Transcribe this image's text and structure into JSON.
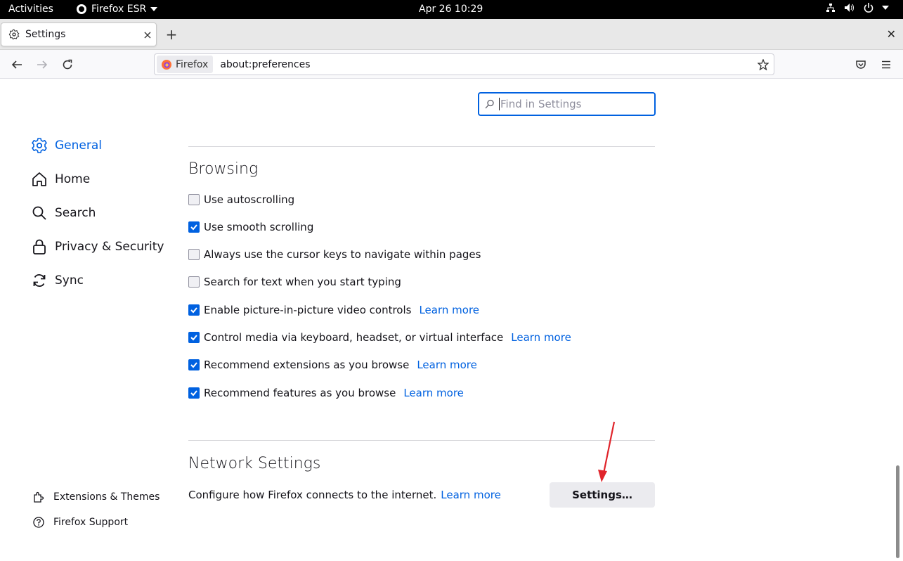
{
  "topbar": {
    "activities": "Activities",
    "app_name": "Firefox ESR",
    "clock": "Apr 26  10:29"
  },
  "tab": {
    "title": "Settings",
    "close": "×",
    "new_tab": "+"
  },
  "urlbar": {
    "identity": "Firefox",
    "url": "about:preferences"
  },
  "search": {
    "placeholder": "Find in Settings"
  },
  "sidebar": {
    "items": [
      {
        "label": "General",
        "icon": "gear-icon",
        "selected": true
      },
      {
        "label": "Home",
        "icon": "home-icon"
      },
      {
        "label": "Search",
        "icon": "search-icon"
      },
      {
        "label": "Privacy & Security",
        "icon": "lock-icon"
      },
      {
        "label": "Sync",
        "icon": "sync-icon"
      }
    ],
    "footer": [
      {
        "label": "Extensions & Themes",
        "icon": "puzzle-icon"
      },
      {
        "label": "Firefox Support",
        "icon": "help-icon"
      }
    ]
  },
  "browsing": {
    "heading": "Browsing",
    "learn_more": "Learn more",
    "options": [
      {
        "label": "Use autoscrolling",
        "checked": false
      },
      {
        "label": "Use smooth scrolling",
        "checked": true
      },
      {
        "label": "Always use the cursor keys to navigate within pages",
        "checked": false
      },
      {
        "label": "Search for text when you start typing",
        "checked": false
      },
      {
        "label": "Enable picture-in-picture video controls",
        "checked": true,
        "learn_more": true
      },
      {
        "label": "Control media via keyboard, headset, or virtual interface",
        "checked": true,
        "learn_more": true
      },
      {
        "label": "Recommend extensions as you browse",
        "checked": true,
        "learn_more": true
      },
      {
        "label": "Recommend features as you browse",
        "checked": true,
        "learn_more": true
      }
    ]
  },
  "network": {
    "heading": "Network Settings",
    "description": "Configure how Firefox connects to the internet.",
    "learn_more": "Learn more",
    "button": "Settings…"
  },
  "colors": {
    "accent": "#0061e0",
    "annotation_arrow": "#e0242b"
  }
}
